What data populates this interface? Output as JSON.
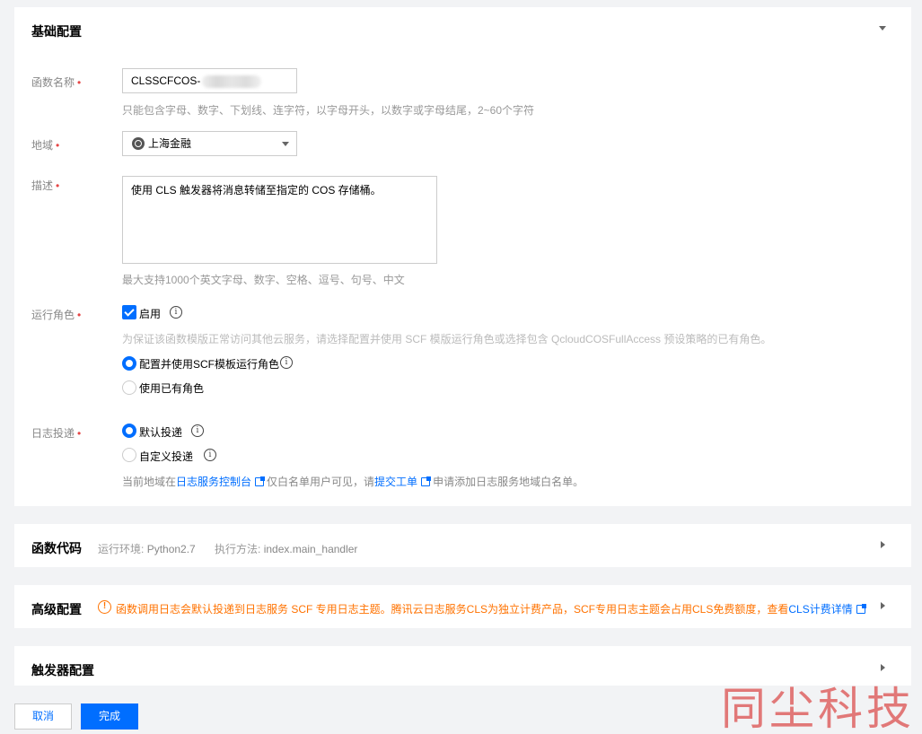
{
  "sections": {
    "basic": {
      "title": "基础配置",
      "function_name": {
        "label": "函数名称",
        "value_prefix": "CLSSCFCOS-",
        "hint": "只能包含字母、数字、下划线、连字符，以字母开头，以数字或字母结尾，2~60个字符"
      },
      "region": {
        "label": "地域",
        "value": "上海金融",
        "icon": "globe-icon"
      },
      "description": {
        "label": "描述",
        "value": "使用 CLS 触发器将消息转储至指定的 COS 存储桶。",
        "hint": "最大支持1000个英文字母、数字、空格、逗号、句号、中文"
      },
      "role": {
        "label": "运行角色",
        "enable_label": "启用",
        "enabled": true,
        "hint": "为保证该函数模版正常访问其他云服务，请选择配置并使用 SCF 模版运行角色或选择包含 QcloudCOSFullAccess 预设策略的已有角色。",
        "options": [
          "配置并使用SCF模板运行角色",
          "使用已有角色"
        ],
        "selected": "配置并使用SCF模板运行角色"
      },
      "log": {
        "label": "日志投递",
        "options": [
          "默认投递",
          "自定义投递"
        ],
        "selected": "默认投递",
        "note_prefix": "当前地域在",
        "note_link1": "日志服务控制台",
        "note_mid": "仅白名单用户可见，请",
        "note_link2": "提交工单",
        "note_suffix": "申请添加日志服务地域白名单。"
      },
      "required_mark": "•"
    },
    "code": {
      "title": "函数代码",
      "runtime_label": "运行环境:",
      "runtime_value": "Python2.7",
      "handler_label": "执行方法:",
      "handler_value": "index.main_handler"
    },
    "advanced": {
      "title": "高级配置",
      "warning": "函数调用日志会默认投递到日志服务 SCF 专用日志主题。腾讯云日志服务CLS为独立计费产品，SCF专用日志主题会占用CLS免费额度，查看",
      "warning_link": "CLS计费详情"
    },
    "trigger": {
      "title": "触发器配置"
    }
  },
  "buttons": {
    "cancel": "取消",
    "done": "完成"
  },
  "watermark": "同尘科技",
  "colors": {
    "primary": "#006eff",
    "warning": "#ff7200",
    "required": "#e54545",
    "watermark": "#e06b6b"
  }
}
